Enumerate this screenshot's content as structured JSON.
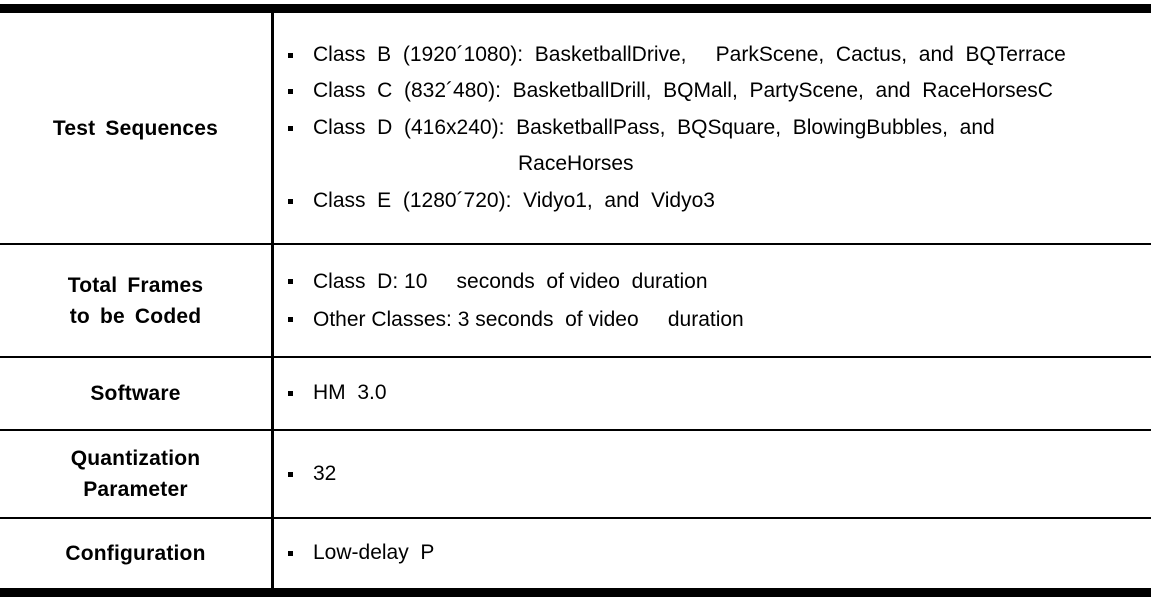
{
  "table": {
    "rows": [
      {
        "label_lines": [
          "Test Sequences"
        ],
        "items": [
          {
            "text": "Class  B  (1920´1080):  BasketballDrive,     ParkScene,  Cactus,  and  BQTerrace"
          },
          {
            "text": "Class  C  (832´480):  BasketballDrill,  BQMall,  PartyScene,  and  RaceHorsesC"
          },
          {
            "text": "Class  D  (416x240):  BasketballPass,  BQSquare,  BlowingBubbles,  and",
            "continuation": "RaceHorses"
          },
          {
            "text": "Class  E  (1280´720):  Vidyo1,  and  Vidyo3"
          }
        ]
      },
      {
        "label_lines": [
          "Total Frames",
          "to be Coded"
        ],
        "items": [
          {
            "text": "Class  D: 10     seconds  of video  duration"
          },
          {
            "text": "Other Classes: 3 seconds  of video     duration"
          }
        ]
      },
      {
        "label_lines": [
          "Software"
        ],
        "items": [
          {
            "text": "HM  3.0"
          }
        ]
      },
      {
        "label_lines": [
          "Quantization",
          "Parameter"
        ],
        "items": [
          {
            "text": "32"
          }
        ]
      },
      {
        "label_lines": [
          "Configuration"
        ],
        "items": [
          {
            "text": "Low-delay  P"
          }
        ]
      }
    ]
  },
  "style": {
    "rule_color": "#000000",
    "text_color": "#000000",
    "background": "#ffffff",
    "bullet_glyph": "square-bullet"
  }
}
